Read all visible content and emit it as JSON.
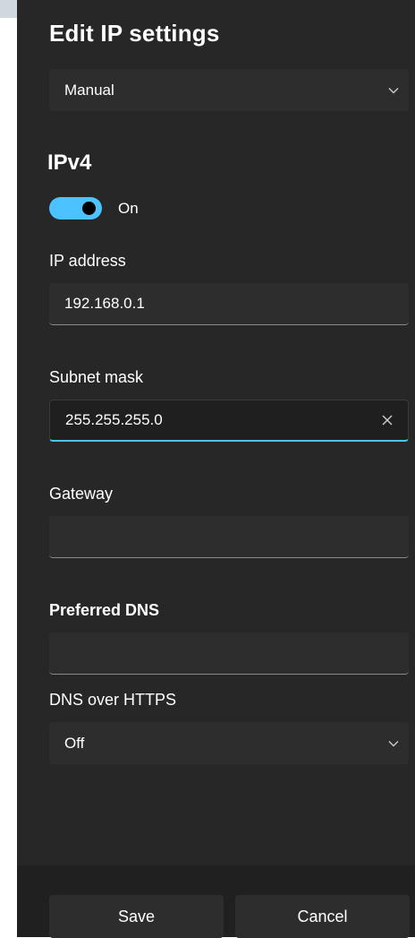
{
  "dialog": {
    "title": "Edit IP settings",
    "mode_select": {
      "value": "Manual",
      "icon": "chevron-down-icon"
    }
  },
  "ipv4": {
    "heading": "IPv4",
    "toggle_state": "On",
    "toggle_on": true,
    "accent_color": "#4cc2ff"
  },
  "fields": {
    "ip_address": {
      "label": "IP address",
      "value": "192.168.0.1"
    },
    "subnet_mask": {
      "label": "Subnet mask",
      "value": "255.255.255.0",
      "clear_icon": "close-icon"
    },
    "gateway": {
      "label": "Gateway",
      "value": ""
    },
    "preferred_dns": {
      "label": "Preferred DNS",
      "value": ""
    },
    "dns_over_https": {
      "label": "DNS over HTTPS",
      "value": "Off",
      "icon": "chevron-down-icon"
    }
  },
  "actions": {
    "save_label": "Save",
    "cancel_label": "Cancel"
  },
  "colors": {
    "panel_bg": "#272727",
    "control_bg": "#2d2d2d",
    "text": "#ffffff",
    "accent": "#4cc2ff"
  }
}
